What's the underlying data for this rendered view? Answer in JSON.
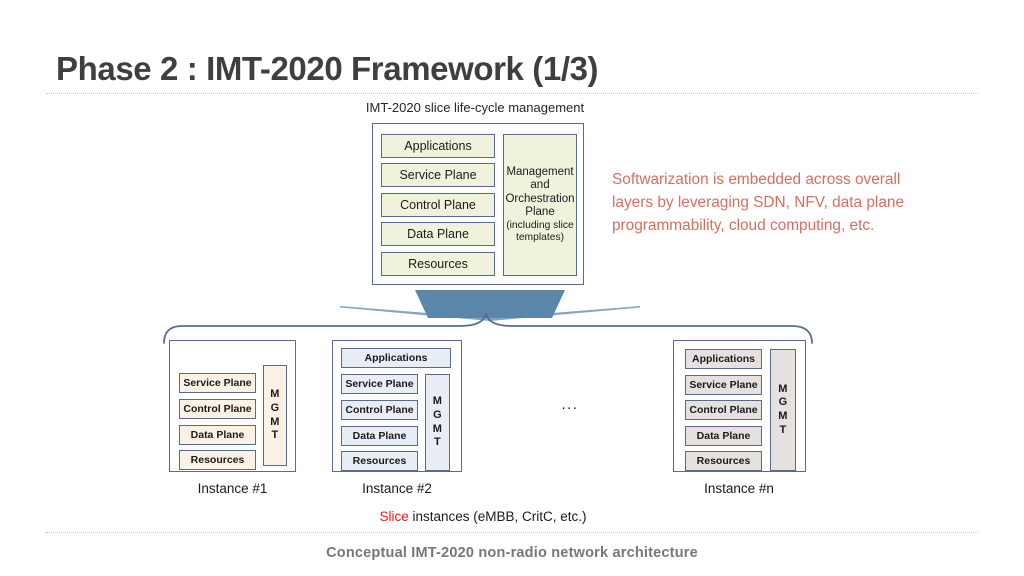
{
  "slide": {
    "title": "Phase 2 : IMT-2020 Framework (1/3)",
    "footer_caption": "Conceptual IMT-2020 non-radio network architecture"
  },
  "diagram": {
    "heading": "IMT-2020 slice life-cycle management",
    "lifecycle_panel": {
      "layers": [
        "Applications",
        "Service Plane",
        "Control Plane",
        "Data Plane",
        "Resources"
      ],
      "mgmt_block": {
        "line1": "Management",
        "line2": "and",
        "line3": "Orchestration",
        "line4": "Plane",
        "note1": "(including slice",
        "note2": "templates)"
      }
    },
    "ellipsis": "...",
    "instances": [
      {
        "label": "Instance #1",
        "layers": [
          "Service Plane",
          "Control Plane",
          "Data Plane",
          "Resources"
        ],
        "mgmt": "MGMT",
        "fill_color": "#fbf1e4"
      },
      {
        "label": "Instance #2",
        "layers": [
          "Applications",
          "Service Plane",
          "Control Plane",
          "Data Plane",
          "Resources"
        ],
        "mgmt": "MGMT",
        "fill_color": "#e9edf5"
      },
      {
        "label": "Instance #n",
        "layers": [
          "Applications",
          "Service Plane",
          "Control Plane",
          "Data Plane",
          "Resources"
        ],
        "mgmt": "MGMT",
        "fill_color": "#e6e0de"
      }
    ],
    "slice_caption": {
      "highlight": "Slice",
      "rest": " instances (eMBB, CritC, etc.)"
    }
  },
  "commentary": {
    "text": "Softwarization is embedded across overall layers by leveraging SDN, NFV, data plane programmability, cloud computing, etc."
  },
  "colors": {
    "title_gray": "#3f3f3f",
    "commentary_salmon": "#d4705f",
    "slice_red": "#e02020",
    "box_border_blue": "#596a8f",
    "lifecycle_fill": "#f1f2dc",
    "funnel_blue": "#5b87ab",
    "brace_blue": "#5a6b92",
    "footer_gray": "#777777"
  }
}
